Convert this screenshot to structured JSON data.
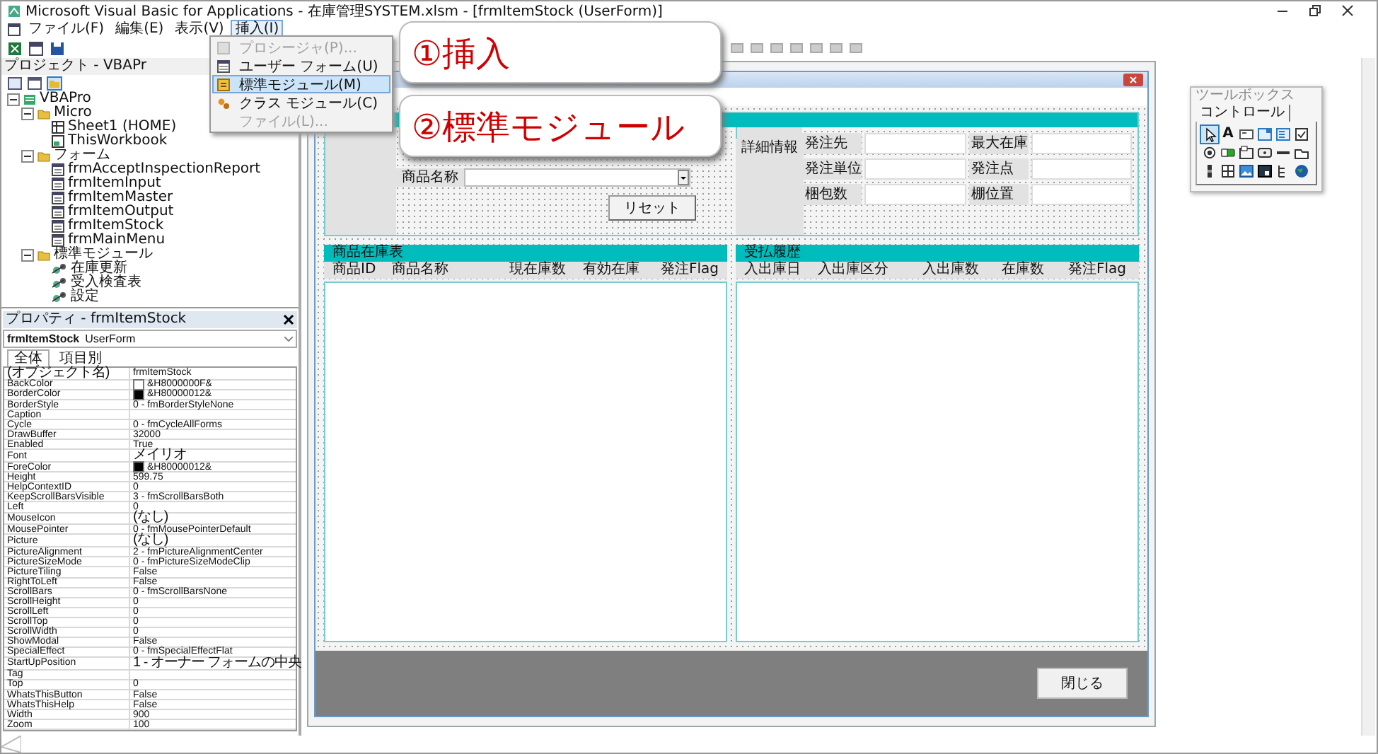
{
  "window": {
    "title": "Microsoft Visual Basic for Applications - 在庫管理SYSTEM.xlsm - [frmItemStock (UserForm)]"
  },
  "menu_bar": [
    {
      "label": "ファイル(F)",
      "selected": false
    },
    {
      "label": "編集(E)",
      "selected": false
    },
    {
      "label": "表示(V)",
      "selected": false
    },
    {
      "label": "挿入(I)",
      "selected": true
    }
  ],
  "insert_menu": [
    {
      "label": "プロシージャ(P)...",
      "kind": "procedure",
      "disabled": true,
      "selected": false
    },
    {
      "label": "ユーザー フォーム(U)",
      "kind": "userform",
      "disabled": false,
      "selected": false
    },
    {
      "label": "標準モジュール(M)",
      "kind": "module",
      "disabled": false,
      "selected": true
    },
    {
      "label": "クラス モジュール(C)",
      "kind": "class",
      "disabled": false,
      "selected": false
    },
    {
      "label": "ファイル(L)...",
      "kind": "file",
      "disabled": true,
      "selected": false
    }
  ],
  "project_explorer": {
    "title": "プロジェクト - VBAPr",
    "tree": [
      {
        "label": "VBAPro",
        "kind": "project",
        "expanded": true,
        "children": [
          {
            "label": "Micro",
            "kind": "folder",
            "expanded": true,
            "children": [
              {
                "label": "Sheet1 (HOME)",
                "kind": "sheet"
              },
              {
                "label": "ThisWorkbook",
                "kind": "workbook"
              }
            ]
          },
          {
            "label": "フォーム",
            "kind": "folder",
            "expanded": true,
            "children": [
              {
                "label": "frmAcceptInspectionReport",
                "kind": "form"
              },
              {
                "label": "frmItemInput",
                "kind": "form"
              },
              {
                "label": "frmItemMaster",
                "kind": "form"
              },
              {
                "label": "frmItemOutput",
                "kind": "form"
              },
              {
                "label": "frmItemStock",
                "kind": "form"
              },
              {
                "label": "frmMainMenu",
                "kind": "form"
              }
            ]
          },
          {
            "label": "標準モジュール",
            "kind": "folder",
            "expanded": true,
            "children": [
              {
                "label": "在庫更新",
                "kind": "module"
              },
              {
                "label": "受入検査表",
                "kind": "module"
              },
              {
                "label": "設定",
                "kind": "module"
              }
            ]
          }
        ]
      }
    ]
  },
  "properties": {
    "title": "プロパティ - frmItemStock",
    "object": {
      "name": "frmItemStock",
      "type": "UserForm"
    },
    "tabs": [
      {
        "label": "全体",
        "selected": true
      },
      {
        "label": "項目別",
        "selected": false
      }
    ],
    "rows": [
      {
        "name": "(オブジェクト名)",
        "value": "frmItemStock"
      },
      {
        "name": "BackColor",
        "value": "&H8000000F&",
        "color": "#ffffff"
      },
      {
        "name": "BorderColor",
        "value": "&H80000012&",
        "color": "#000000"
      },
      {
        "name": "BorderStyle",
        "value": "0 - fmBorderStyleNone"
      },
      {
        "name": "Caption"
      },
      {
        "name": "Cycle",
        "value": "0 - fmCycleAllForms"
      },
      {
        "name": "DrawBuffer",
        "value": "32000"
      },
      {
        "name": "Enabled",
        "value": "True"
      },
      {
        "name": "Font",
        "value": "メイリオ"
      },
      {
        "name": "ForeColor",
        "value": "&H80000012&",
        "color": "#000000"
      },
      {
        "name": "Height",
        "value": "599.75"
      },
      {
        "name": "HelpContextID",
        "value": "0"
      },
      {
        "name": "KeepScrollBarsVisible",
        "value": "3 - fmScrollBarsBoth"
      },
      {
        "name": "Left",
        "value": "0"
      },
      {
        "name": "MouseIcon",
        "value": "(なし)"
      },
      {
        "name": "MousePointer",
        "value": "0 - fmMousePointerDefault"
      },
      {
        "name": "Picture",
        "value": "(なし)"
      },
      {
        "name": "PictureAlignment",
        "value": "2 - fmPictureAlignmentCenter"
      },
      {
        "name": "PictureSizeMode",
        "value": "0 - fmPictureSizeModeClip"
      },
      {
        "name": "PictureTiling",
        "value": "False"
      },
      {
        "name": "RightToLeft",
        "value": "False"
      },
      {
        "name": "ScrollBars",
        "value": "0 - fmScrollBarsNone"
      },
      {
        "name": "ScrollHeight",
        "value": "0"
      },
      {
        "name": "ScrollLeft",
        "value": "0"
      },
      {
        "name": "ScrollTop",
        "value": "0"
      },
      {
        "name": "ScrollWidth",
        "value": "0"
      },
      {
        "name": "ShowModal",
        "value": "False"
      },
      {
        "name": "SpecialEffect",
        "value": "0 - fmSpecialEffectFlat"
      },
      {
        "name": "StartUpPosition",
        "value": "1 - オーナー フォームの中央"
      },
      {
        "name": "Tag"
      },
      {
        "name": "Top",
        "value": "0"
      },
      {
        "name": "WhatsThisButton",
        "value": "False"
      },
      {
        "name": "WhatsThisHelp",
        "value": "False"
      },
      {
        "name": "Width",
        "value": "900"
      },
      {
        "name": "Zoom",
        "value": "100"
      }
    ]
  },
  "form": {
    "search": {
      "label": "商品名称",
      "reset_button": "リセット"
    },
    "details": {
      "label": "詳細情報",
      "fields": [
        "発注先",
        "最大在庫",
        "発注単位",
        "発注点",
        "梱包数",
        "棚位置"
      ]
    },
    "stock_table": {
      "title": "商品在庫表",
      "columns": [
        "商品ID",
        "商品名称",
        "現在庫数",
        "有効在庫",
        "発注Flag"
      ]
    },
    "history_table": {
      "title": "受払履歴",
      "columns": [
        "入出庫日",
        "入出庫区分",
        "入出庫数",
        "在庫数",
        "発注Flag"
      ]
    },
    "close_button": "閉じる"
  },
  "toolbox": {
    "title": "ツールボックス",
    "tab": "コントロール",
    "tools": [
      {
        "kind": "pointer",
        "selected": true
      },
      {
        "kind": "label",
        "glyph": "A",
        "selected": false
      },
      {
        "kind": "textbox",
        "selected": false
      },
      {
        "kind": "combo",
        "selected": false
      },
      {
        "kind": "list",
        "selected": false
      },
      {
        "kind": "check",
        "selected": false
      },
      {
        "kind": "option",
        "selected": false
      },
      {
        "kind": "toggle",
        "selected": false
      },
      {
        "kind": "frame",
        "selected": false
      },
      {
        "kind": "button",
        "selected": false
      },
      {
        "kind": "tabstrip",
        "selected": false
      },
      {
        "kind": "multipage",
        "selected": false
      },
      {
        "kind": "scrollbar",
        "selected": false
      },
      {
        "kind": "spin",
        "selected": false
      },
      {
        "kind": "image",
        "selected": false
      },
      {
        "kind": "refedit",
        "selected": false
      },
      {
        "kind": "tree",
        "selected": false
      },
      {
        "kind": "globe",
        "selected": false
      }
    ]
  },
  "callouts": [
    {
      "text": "①挿入"
    },
    {
      "text": "②標準モジュール"
    }
  ]
}
